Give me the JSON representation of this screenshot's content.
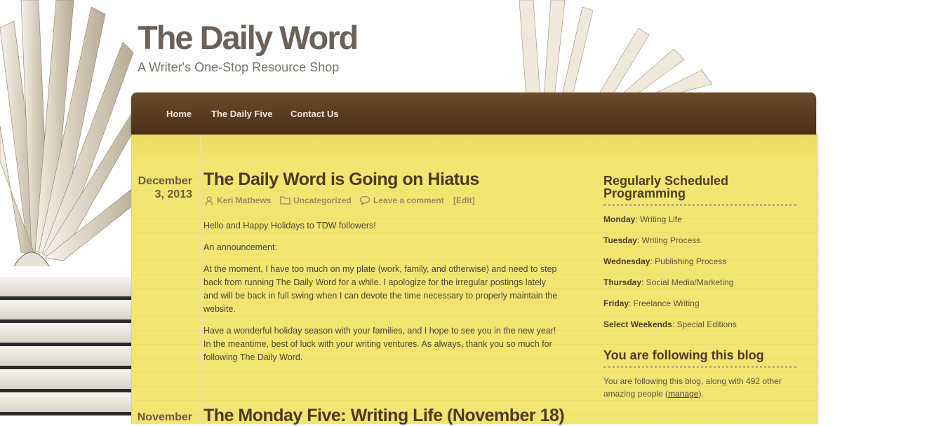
{
  "site": {
    "title": "The Daily Word",
    "tagline": "A Writer's One-Stop Resource Shop"
  },
  "nav": {
    "items": [
      {
        "label": "Home"
      },
      {
        "label": "The Daily Five"
      },
      {
        "label": "Contact Us"
      }
    ]
  },
  "posts": [
    {
      "date": "December 3, 2013",
      "title": "The Daily Word is Going on Hiatus",
      "author": "Keri Mathews",
      "category": "Uncategorized",
      "comment": "Leave a comment",
      "edit": "[Edit]",
      "paragraphs": [
        "Hello and Happy Holidays to TDW followers!",
        "An announcement:",
        "At the moment, I have too much on my plate (work, family, and otherwise) and need to step back from running The Daily Word for a while. I apologize for the irregular postings lately and will be back in full swing when I can devote the time necessary to properly maintain the website.",
        "Have a wonderful holiday season with your families, and I hope to see you in the new year! In the meantime, best of luck with your writing ventures. As always, thank you so much for following The Daily Word."
      ]
    },
    {
      "date": "November",
      "title": "The Monday Five: Writing Life (November 18)"
    }
  ],
  "sidebar": {
    "schedule": {
      "title": "Regularly Scheduled Programming",
      "items": [
        {
          "day": "Monday",
          "topic": ": Writing Life"
        },
        {
          "day": "Tuesday",
          "topic": ": Writing Process"
        },
        {
          "day": "Wednesday",
          "topic": ": Publishing Process"
        },
        {
          "day": "Thursday",
          "topic": ": Social Media/Marketing"
        },
        {
          "day": "Friday",
          "topic": ": Freelance Writing"
        },
        {
          "day": "Select Weekends",
          "topic": ": Special Editions"
        }
      ]
    },
    "follow": {
      "title": "You are following this blog",
      "text_before": "You are following this blog, along with 492 other amazing people (",
      "link": "manage",
      "text_after": ")."
    }
  },
  "colors": {
    "nav_bg": "#4a2f17",
    "paper": "#fbf6c2",
    "title": "#4d3a24"
  },
  "icons": [
    "person-icon",
    "folder-icon",
    "comment-icon"
  ]
}
